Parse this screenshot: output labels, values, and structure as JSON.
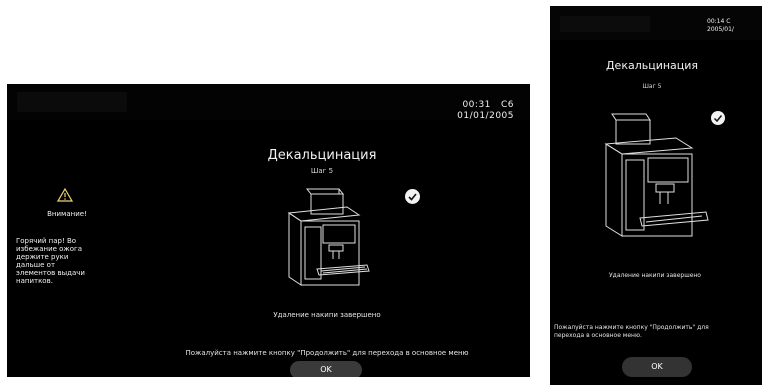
{
  "screen_a": {
    "time": "00:31",
    "status_code": "C6",
    "date": "01/01/2005",
    "title": "Декальцинация",
    "step": "Шаг 5",
    "status_message": "Удаление накипи завершено",
    "instruction": "Пожалуйста нажмите кнопку \"Продолжить\" для перехода в основное меню",
    "ok_label": "OK",
    "warning": {
      "title": "Внимание!",
      "lines": [
        "Горячий пар! Во",
        "избежание ожога",
        "держите руки",
        "дальше от",
        "элементов выдачи",
        "напитков."
      ]
    }
  },
  "screen_b": {
    "time_partial": "00:14   C",
    "date_partial": "2005/01/",
    "title": "Декальцинация",
    "step": "Шаг 5",
    "status_message": "Удаление накипи завершено",
    "instruction_line1": "Пожалуйста нажмите кнопку \"Продолжить\" для",
    "instruction_line2": "перехода в основное меню.",
    "ok_label": "OK"
  },
  "colors": {
    "background": "#000000",
    "text": "#f2f2f2",
    "button": "#3a3a3a",
    "warning_icon": "#e8d870"
  },
  "icons": [
    "warning-triangle-icon",
    "checkmark-icon",
    "coffee-machine-illustration"
  ]
}
